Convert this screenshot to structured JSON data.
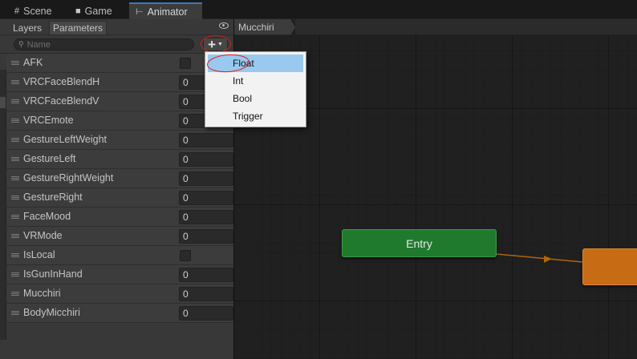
{
  "tabs": [
    {
      "icon": "grid-icon",
      "label": "Scene"
    },
    {
      "icon": "gamepad-icon",
      "label": "Game"
    },
    {
      "icon": "animator-icon",
      "label": "Animator",
      "active": true
    }
  ],
  "left_panel": {
    "subtabs": [
      "Layers",
      "Parameters"
    ],
    "active_subtab": "Parameters",
    "search": {
      "placeholder": "Name",
      "value": ""
    },
    "add_button": "+",
    "parameters": [
      {
        "name": "AFK",
        "type": "bool",
        "value": false
      },
      {
        "name": "VRCFaceBlendH",
        "type": "value",
        "value": "0"
      },
      {
        "name": "VRCFaceBlendV",
        "type": "value",
        "value": "0"
      },
      {
        "name": "VRCEmote",
        "type": "value",
        "value": "0"
      },
      {
        "name": "GestureLeftWeight",
        "type": "value",
        "value": "0"
      },
      {
        "name": "GestureLeft",
        "type": "value",
        "value": "0"
      },
      {
        "name": "GestureRightWeight",
        "type": "value",
        "value": "0"
      },
      {
        "name": "GestureRight",
        "type": "value",
        "value": "0"
      },
      {
        "name": "FaceMood",
        "type": "value",
        "value": "0"
      },
      {
        "name": "VRMode",
        "type": "value",
        "value": "0"
      },
      {
        "name": "IsLocal",
        "type": "bool",
        "value": false
      },
      {
        "name": "IsGunInHand",
        "type": "value",
        "value": "0"
      },
      {
        "name": "Mucchiri",
        "type": "value",
        "value": "0"
      },
      {
        "name": "BodyMicchiri",
        "type": "value",
        "value": "0"
      }
    ]
  },
  "graph": {
    "breadcrumb": "Mucchiri",
    "entry_label": "Entry"
  },
  "dropdown": {
    "items": [
      "Float",
      "Int",
      "Bool",
      "Trigger"
    ],
    "highlighted": "Float"
  },
  "colors": {
    "entry_node": "#1f7a2d",
    "state_node": "#c76b14",
    "transition": "#b0650f",
    "highlight": "#99c9ef",
    "annotation": "#e01a1a",
    "tab_accent": "#3a79bb"
  }
}
